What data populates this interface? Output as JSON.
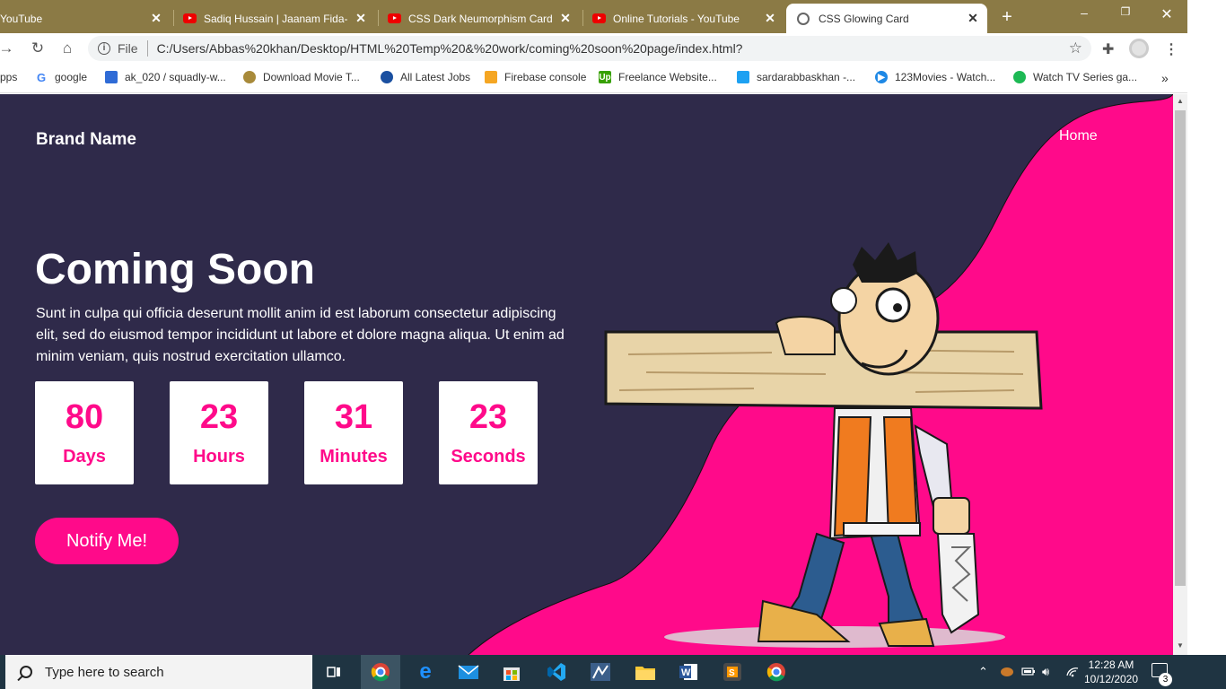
{
  "browser": {
    "tabs": [
      {
        "title": "YouTube"
      },
      {
        "title": "Sadiq Hussain | Jaanam Fida-e"
      },
      {
        "title": "CSS Dark Neumorphism Cards"
      },
      {
        "title": "Online Tutorials - YouTube"
      },
      {
        "title": "CSS Glowing Card"
      }
    ],
    "address": {
      "scheme_label": "File",
      "url": "C:/Users/Abbas%20khan/Desktop/HTML%20Temp%20&%20work/coming%20soon%20page/index.html?"
    },
    "bookmarks": [
      {
        "label": "Apps"
      },
      {
        "label": "google"
      },
      {
        "label": "ak_020 / squadly-w..."
      },
      {
        "label": "Download Movie T..."
      },
      {
        "label": "All Latest Jobs"
      },
      {
        "label": "Firebase console"
      },
      {
        "label": "Freelance Website..."
      },
      {
        "label": "sardarabbaskhan -..."
      },
      {
        "label": "123Movies - Watch..."
      },
      {
        "label": "Watch TV Series ga..."
      }
    ],
    "more_bookmarks": "»"
  },
  "page": {
    "brand": "Brand Name",
    "nav": {
      "home": "Home"
    },
    "headline": "Coming Soon",
    "lead": "Sunt in culpa qui officia deserunt mollit anim id est laborum consectetur adipiscing elit, sed do eiusmod tempor incididunt ut labore et dolore magna aliqua. Ut enim ad minim veniam, quis nostrud exercitation ullamco.",
    "countdown": [
      {
        "value": "80",
        "unit": "Days"
      },
      {
        "value": "23",
        "unit": "Hours"
      },
      {
        "value": "31",
        "unit": "Minutes"
      },
      {
        "value": "23",
        "unit": "Seconds"
      }
    ],
    "cta": "Notify Me!",
    "colors": {
      "background": "#2f2a4a",
      "accent": "#ff0a8a",
      "text": "#ffffff"
    }
  },
  "taskbar": {
    "search_placeholder": "Type here to search",
    "time": "12:28 AM",
    "date": "10/12/2020",
    "notifications": "3"
  }
}
